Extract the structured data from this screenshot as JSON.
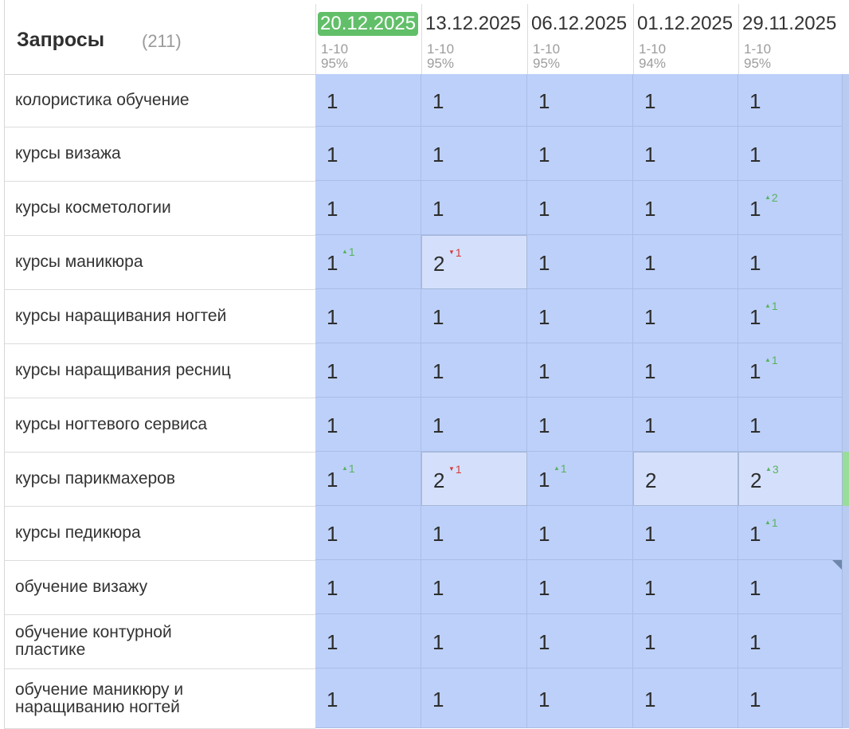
{
  "header": {
    "title": "Запросы",
    "count": "(211)"
  },
  "dates": [
    {
      "date": "20.12.2025",
      "range": "1-10",
      "percent": "95%",
      "active": true
    },
    {
      "date": "13.12.2025",
      "range": "1-10",
      "percent": "95%",
      "active": false
    },
    {
      "date": "06.12.2025",
      "range": "1-10",
      "percent": "95%",
      "active": false
    },
    {
      "date": "01.12.2025",
      "range": "1-10",
      "percent": "94%",
      "active": false
    },
    {
      "date": "29.11.2025",
      "range": "1-10",
      "percent": "95%",
      "active": false
    }
  ],
  "rows": [
    {
      "query": "колористика обучение",
      "cells": [
        {
          "v": "1"
        },
        {
          "v": "1"
        },
        {
          "v": "1"
        },
        {
          "v": "1"
        },
        {
          "v": "1"
        }
      ]
    },
    {
      "query": "курсы визажа",
      "cells": [
        {
          "v": "1"
        },
        {
          "v": "1"
        },
        {
          "v": "1"
        },
        {
          "v": "1"
        },
        {
          "v": "1"
        }
      ]
    },
    {
      "query": "курсы косметологии",
      "cells": [
        {
          "v": "1"
        },
        {
          "v": "1"
        },
        {
          "v": "1"
        },
        {
          "v": "1"
        },
        {
          "v": "1",
          "d": "2",
          "dir": "up"
        }
      ]
    },
    {
      "query": "курсы маникюра",
      "cells": [
        {
          "v": "1",
          "d": "1",
          "dir": "up"
        },
        {
          "v": "2",
          "d": "1",
          "dir": "down",
          "light": true
        },
        {
          "v": "1"
        },
        {
          "v": "1"
        },
        {
          "v": "1"
        }
      ]
    },
    {
      "query": "курсы наращивания ногтей",
      "cells": [
        {
          "v": "1"
        },
        {
          "v": "1"
        },
        {
          "v": "1"
        },
        {
          "v": "1"
        },
        {
          "v": "1",
          "d": "1",
          "dir": "up"
        }
      ]
    },
    {
      "query": "курсы наращивания ресниц",
      "cells": [
        {
          "v": "1"
        },
        {
          "v": "1"
        },
        {
          "v": "1"
        },
        {
          "v": "1"
        },
        {
          "v": "1",
          "d": "1",
          "dir": "up"
        }
      ]
    },
    {
      "query": "курсы ногтевого сервиса",
      "cells": [
        {
          "v": "1"
        },
        {
          "v": "1"
        },
        {
          "v": "1"
        },
        {
          "v": "1"
        },
        {
          "v": "1"
        }
      ]
    },
    {
      "query": "курсы парикмахеров",
      "cells": [
        {
          "v": "1",
          "d": "1",
          "dir": "up"
        },
        {
          "v": "2",
          "d": "1",
          "dir": "down",
          "light": true
        },
        {
          "v": "1",
          "d": "1",
          "dir": "up"
        },
        {
          "v": "2",
          "light": true
        },
        {
          "v": "2",
          "d": "3",
          "dir": "up",
          "light": true
        }
      ]
    },
    {
      "query": "курсы педикюра",
      "cells": [
        {
          "v": "1"
        },
        {
          "v": "1"
        },
        {
          "v": "1"
        },
        {
          "v": "1"
        },
        {
          "v": "1",
          "d": "1",
          "dir": "up"
        }
      ]
    },
    {
      "query": "обучение визажу",
      "cells": [
        {
          "v": "1"
        },
        {
          "v": "1"
        },
        {
          "v": "1"
        },
        {
          "v": "1"
        },
        {
          "v": "1",
          "mark": true
        }
      ]
    },
    {
      "query": "обучение контурной пластике",
      "cells": [
        {
          "v": "1"
        },
        {
          "v": "1"
        },
        {
          "v": "1"
        },
        {
          "v": "1"
        },
        {
          "v": "1"
        }
      ]
    },
    {
      "query": "обучение маникюру и наращиванию ногтей",
      "cells": [
        {
          "v": "1"
        },
        {
          "v": "1"
        },
        {
          "v": "1"
        },
        {
          "v": "1"
        },
        {
          "v": "1"
        }
      ]
    }
  ]
}
